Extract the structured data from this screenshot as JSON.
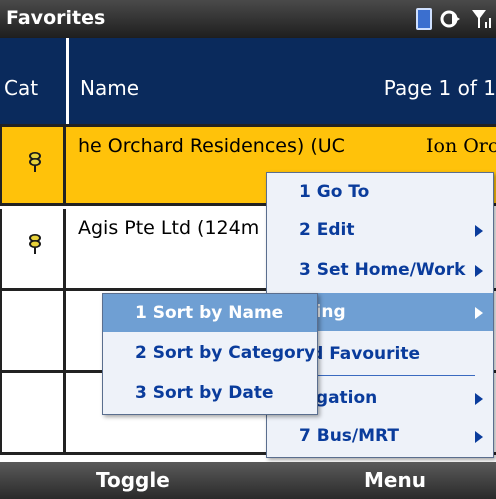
{
  "titlebar": {
    "title": "Favorites",
    "icons": [
      "phone-icon",
      "connection-icon",
      "signal-icon"
    ]
  },
  "header": {
    "cat_label": "Cat",
    "name_label": "Name",
    "page_label": "Page 1 of 1"
  },
  "rows": [
    {
      "name": "he Orchard Residences) (UC",
      "extra": "Ion Orc",
      "selected": true
    },
    {
      "name": "Agis Pte Ltd (124m",
      "extra": "",
      "selected": false
    },
    {
      "name": "",
      "extra": "",
      "selected": false
    },
    {
      "name": "",
      "extra": "",
      "selected": false
    }
  ],
  "main_menu": {
    "items": [
      {
        "label": "1 Go To",
        "has_submenu": false
      },
      {
        "label": "2 Edit",
        "has_submenu": true
      },
      {
        "label": "3 Set Home/Work",
        "has_submenu": true
      },
      {
        "label": "rting",
        "has_submenu": true
      },
      {
        "label": "nd Favourite",
        "has_submenu": false
      },
      {
        "label": "vigation",
        "has_submenu": true
      },
      {
        "label": "7 Bus/MRT",
        "has_submenu": true
      }
    ]
  },
  "sort_menu": {
    "items": [
      {
        "label": "1 Sort by Name"
      },
      {
        "label": "2 Sort by Category"
      },
      {
        "label": "3 Sort by Date"
      }
    ]
  },
  "softkeys": {
    "left": "Toggle",
    "right": "Menu"
  },
  "colors": {
    "header_bg": "#0a2a5c",
    "selected_row": "#ffc20a",
    "menu_highlight": "#6f9fd3",
    "menu_text": "#0a3c9c"
  }
}
